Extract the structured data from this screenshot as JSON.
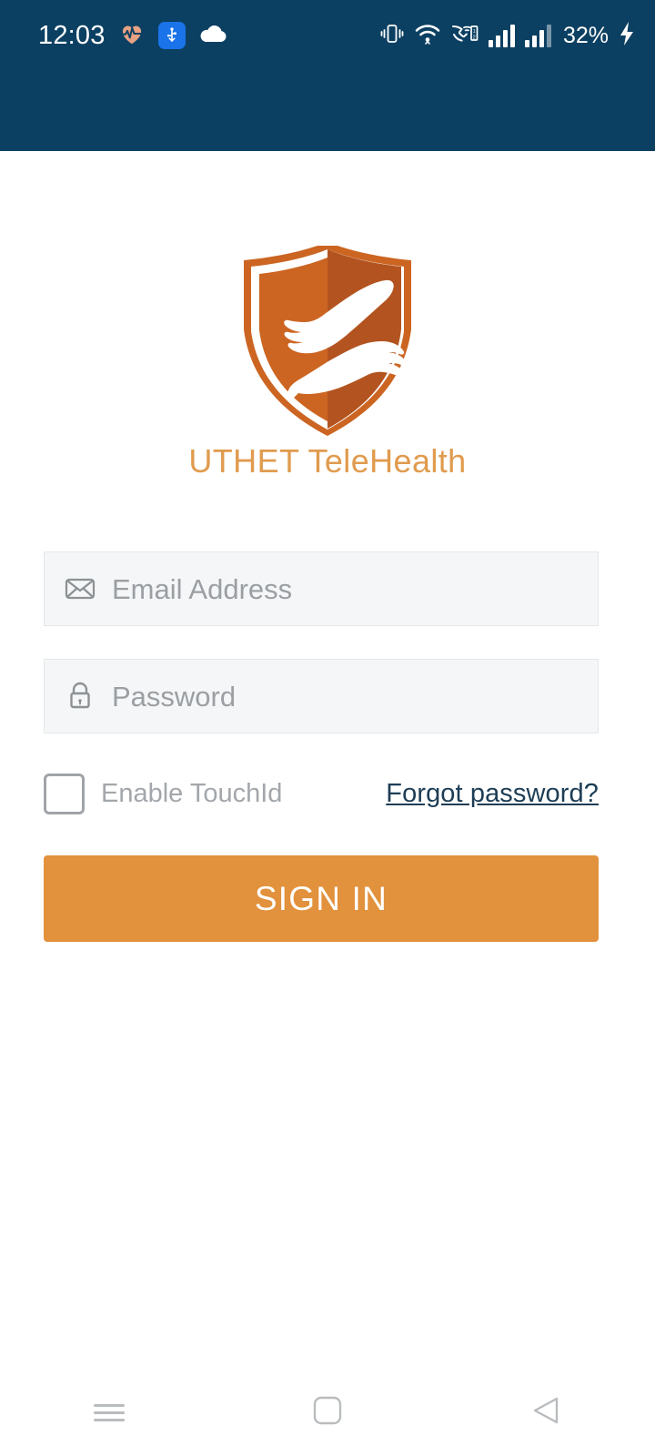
{
  "status_bar": {
    "time": "12:03",
    "battery_percent": "32%",
    "left_icons": [
      "heart-pulse-icon",
      "usb-icon",
      "cloud-icon"
    ],
    "right_icons": [
      "vibrate-icon",
      "wifi-icon",
      "vowifi-call-icon",
      "signal-sim1-icon",
      "signal-sim2-icon",
      "charging-bolt-icon"
    ],
    "background_color": "#0c4062"
  },
  "branding": {
    "logo_name": "uthet-shield-hands-logo",
    "app_title": "UTHET TeleHealth",
    "title_color": "#e09b4e",
    "shield_light_color": "#cc6522",
    "shield_dark_color": "#b35420"
  },
  "form": {
    "email": {
      "icon": "envelope-icon",
      "placeholder": "Email Address",
      "value": ""
    },
    "password": {
      "icon": "lock-icon",
      "placeholder": "Password",
      "value": ""
    },
    "touch_id": {
      "label": "Enable TouchId",
      "checked": false
    },
    "forgot_password_label": "Forgot password?",
    "forgot_password_color": "#1d3d55",
    "sign_in_label": "SIGN IN",
    "sign_in_color": "#e2913c"
  },
  "navigation_bar": {
    "recents_label": "recent-apps",
    "home_label": "home",
    "back_label": "back"
  }
}
